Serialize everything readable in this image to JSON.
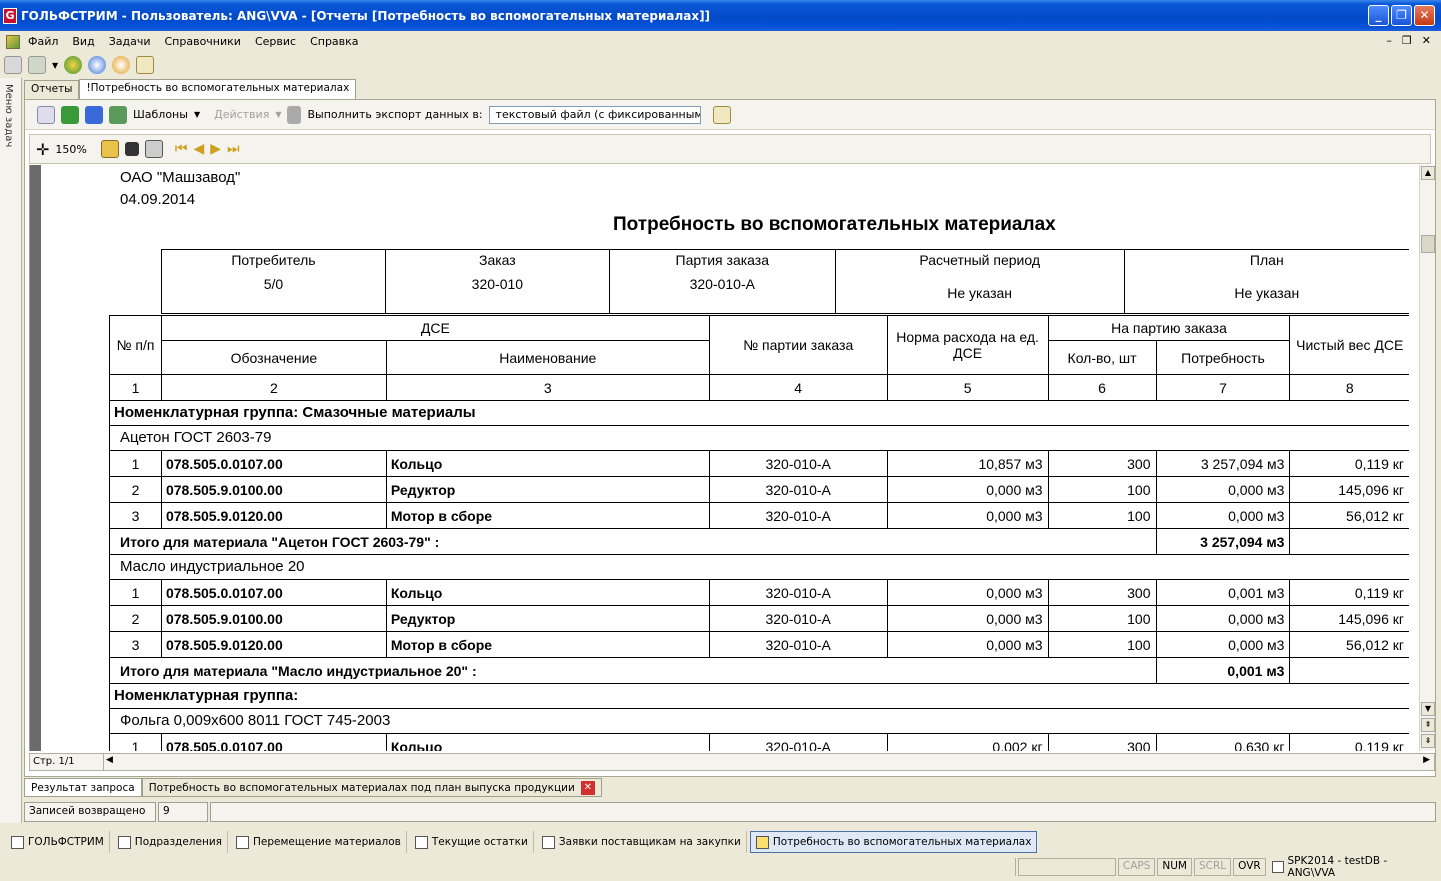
{
  "window": {
    "title": "ГОЛЬФСТРИМ - Пользователь: ANG\\VVA - [Отчеты  [Потребность во вспомогательных материалах]]"
  },
  "menu": [
    "Файл",
    "Вид",
    "Задачи",
    "Справочники",
    "Сервис",
    "Справка"
  ],
  "left_strip": "Меню задач",
  "doc_tabs": [
    "Отчеты",
    "!Потребность во вспомогательных материалах"
  ],
  "toolbar": {
    "templates": "Шаблоны",
    "actions": "Действия",
    "export_label": "Выполнить экспорт данных в:",
    "export_target": "текстовый файл (с фиксированным"
  },
  "preview": {
    "zoom": "150%",
    "page_status": "Стр. 1/1"
  },
  "report": {
    "company": "ОАО \"Машзавод\"",
    "date": "04.09.2014",
    "title": "Потребность во вспомогательных материалах",
    "head": {
      "consumer_label": "Потребитель",
      "consumer_value": "5/0",
      "order_label": "Заказ",
      "order_value": "320-010",
      "batch_label": "Партия заказа",
      "batch_value": "320-010-А",
      "period_label": "Расчетный период",
      "period_value": "Не указан",
      "plan_label": "План",
      "plan_value": "Не указан"
    },
    "columns": {
      "num": "№ п/п",
      "dse": "ДСЕ",
      "designation": "Обозначение",
      "name": "Наименование",
      "batch_no": "№ партии заказа",
      "norm": "Норма расхода на ед. ДСЕ",
      "per_batch": "На партию заказа",
      "qty": "Кол-во, шт",
      "need": "Потребность",
      "net_weight": "Чистый вес ДСЕ",
      "indices": [
        "1",
        "2",
        "3",
        "4",
        "5",
        "6",
        "7",
        "8"
      ]
    },
    "groups": [
      {
        "label": "Номенклатурная группа: Смазочные материалы",
        "materials": [
          {
            "name": "Ацетон ГОСТ 2603-79",
            "rows": [
              {
                "n": "1",
                "code": "078.505.0.0107.00",
                "name": "Кольцо",
                "batch": "320-010-А",
                "norm": "10,857 м3",
                "qty": "300",
                "need": "3 257,094 м3",
                "weight": "0,119 кг"
              },
              {
                "n": "2",
                "code": "078.505.9.0100.00",
                "name": "Редуктор",
                "batch": "320-010-А",
                "norm": "0,000 м3",
                "qty": "100",
                "need": "0,000 м3",
                "weight": "145,096 кг"
              },
              {
                "n": "3",
                "code": "078.505.9.0120.00",
                "name": "Мотор в сборе",
                "batch": "320-010-А",
                "norm": "0,000 м3",
                "qty": "100",
                "need": "0,000 м3",
                "weight": "56,012 кг"
              }
            ],
            "total_label": "Итого для материала \"Ацетон ГОСТ 2603-79\" :",
            "total_value": "3 257,094  м3"
          },
          {
            "name": "Масло индустриальное 20",
            "rows": [
              {
                "n": "1",
                "code": "078.505.0.0107.00",
                "name": "Кольцо",
                "batch": "320-010-А",
                "norm": "0,000 м3",
                "qty": "300",
                "need": "0,001 м3",
                "weight": "0,119 кг"
              },
              {
                "n": "2",
                "code": "078.505.9.0100.00",
                "name": "Редуктор",
                "batch": "320-010-А",
                "norm": "0,000 м3",
                "qty": "100",
                "need": "0,000 м3",
                "weight": "145,096 кг"
              },
              {
                "n": "3",
                "code": "078.505.9.0120.00",
                "name": "Мотор в сборе",
                "batch": "320-010-А",
                "norm": "0,000 м3",
                "qty": "100",
                "need": "0,000 м3",
                "weight": "56,012 кг"
              }
            ],
            "total_label": "Итого для материала \"Масло индустриальное 20\" :",
            "total_value": "0,001  м3"
          }
        ]
      },
      {
        "label": "Номенклатурная группа:",
        "materials": [
          {
            "name": "Фольга 0,009х600 8011 ГОСТ 745-2003",
            "rows": [
              {
                "n": "1",
                "code": "078.505.0.0107.00",
                "name": "Кольцо",
                "batch": "320-010-А",
                "norm": "0,002 кг",
                "qty": "300",
                "need": "0,630 кг",
                "weight": "0,119 кг"
              }
            ]
          }
        ]
      }
    ]
  },
  "result_tabs": [
    "Результат запроса",
    "Потребность во вспомогательных материалах под план выпуска продукции"
  ],
  "records": {
    "label": "Записей возвращено",
    "count": "9"
  },
  "taskbar": [
    "ГОЛЬФСТРИМ",
    "Подразделения",
    "Перемещение материалов",
    "Текущие остатки",
    "Заявки поставщикам на закупки",
    "Потребность во вспомогательных материалах"
  ],
  "status": {
    "caps": "CAPS",
    "num": "NUM",
    "scrl": "SCRL",
    "ovr": "OVR",
    "db": "SPK2014 - testDB - ANG\\VVA"
  }
}
